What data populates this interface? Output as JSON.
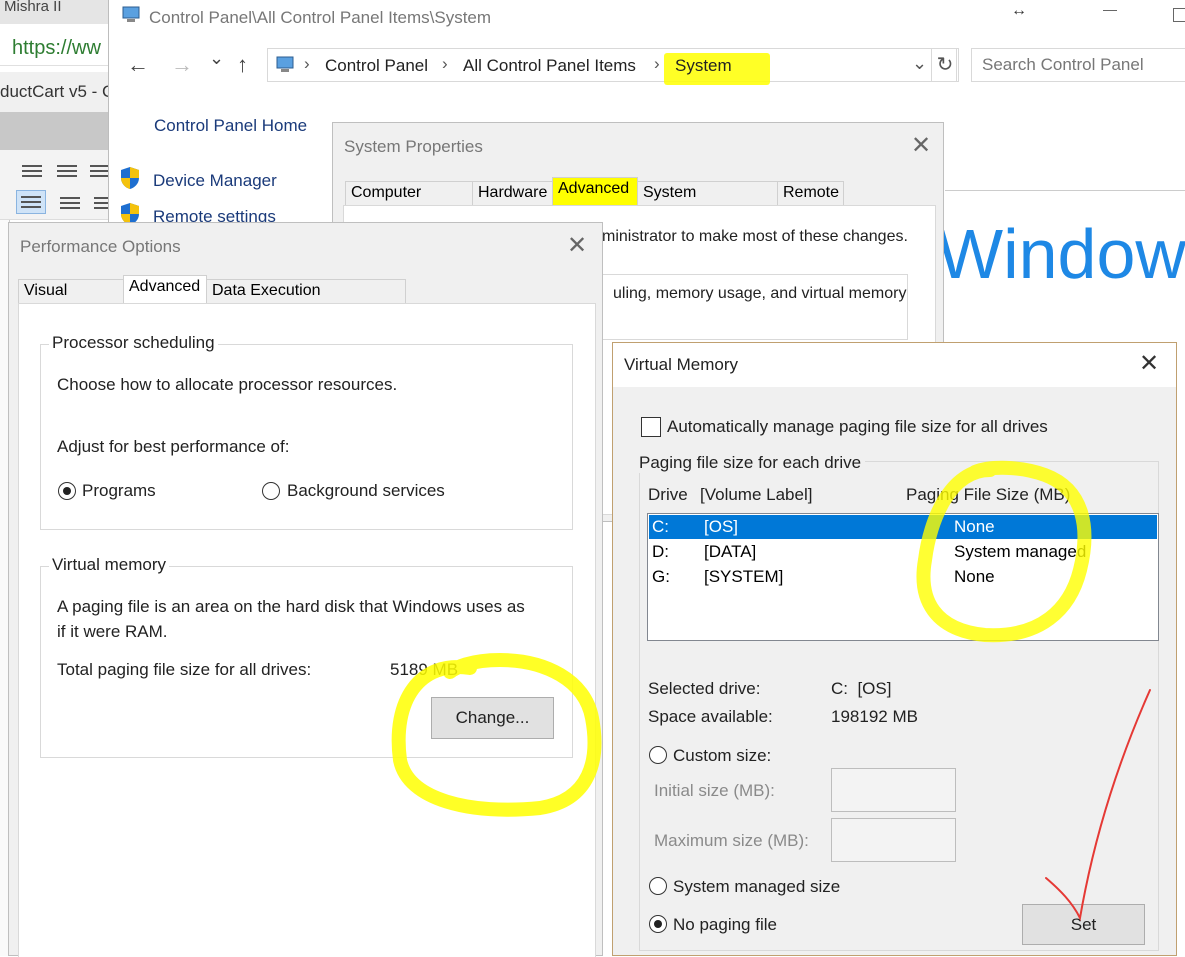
{
  "background_browser": {
    "tab_title": "Mishra II",
    "url_text": "https://ww",
    "app_title": "ductCart v5 - C"
  },
  "control_panel": {
    "title": "Control Panel\\All Control Panel Items\\System",
    "breadcrumbs": [
      "Control Panel",
      "All Control Panel Items",
      "System"
    ],
    "search_placeholder": "Search Control Panel",
    "home_link": "Control Panel Home",
    "links": [
      "Device Manager",
      "Remote settings"
    ],
    "windows_logo_text": "Windows",
    "icons": {
      "back": "←",
      "forward": "→",
      "recent": "⌄",
      "up": "↑",
      "dropdown": "⌄",
      "refresh": "↻",
      "resize": "↔"
    }
  },
  "system_properties": {
    "title": "System Properties",
    "tabs": [
      "Computer Name",
      "Hardware",
      "Advanced",
      "System Protection",
      "Remote"
    ],
    "active_tab": "Advanced",
    "text1": "ministrator to make most of these changes.",
    "text2": "uling, memory usage, and virtual memory"
  },
  "performance_options": {
    "title": "Performance Options",
    "tabs": [
      "Visual Effects",
      "Advanced",
      "Data Execution Prevention"
    ],
    "active_tab": "Advanced",
    "processor_group_title": "Processor scheduling",
    "processor_desc": "Choose how to allocate processor resources.",
    "adjust_label": "Adjust for best performance of:",
    "radio_programs": "Programs",
    "radio_background": "Background services",
    "vm_group_title": "Virtual memory",
    "vm_desc_line1": "A paging file is an area on the hard disk that Windows uses as",
    "vm_desc_line2": "if it were RAM.",
    "total_label": "Total paging file size for all drives:",
    "total_value": "5189 MB",
    "change_button": "Change..."
  },
  "virtual_memory": {
    "title": "Virtual Memory",
    "auto_manage_label": "Automatically manage paging file size for all drives",
    "auto_manage_checked": false,
    "group_title": "Paging file size for each drive",
    "col_drive": "Drive",
    "col_volume": "[Volume Label]",
    "col_size": "Paging File Size (MB)",
    "drives": [
      {
        "drive": "C:",
        "label": "[OS]",
        "size": "None",
        "selected": true
      },
      {
        "drive": "D:",
        "label": "[DATA]",
        "size": "System managed",
        "selected": false
      },
      {
        "drive": "G:",
        "label": "[SYSTEM]",
        "size": "None",
        "selected": false
      }
    ],
    "selected_drive_label": "Selected drive:",
    "selected_drive_value": "C:  [OS]",
    "space_label": "Space available:",
    "space_value": "198192 MB",
    "custom_size_label": "Custom size:",
    "initial_size_label": "Initial size (MB):",
    "maximum_size_label": "Maximum size (MB):",
    "system_managed_label": "System managed size",
    "no_paging_label": "No paging file",
    "selected_option": "No paging file",
    "set_button": "Set"
  },
  "colors": {
    "highlight_yellow": "#ffff00",
    "annotation_red": "#e53935",
    "selection_blue": "#0078d7",
    "link_blue": "#1a3a7a",
    "windows_blue": "#1e88e5"
  }
}
